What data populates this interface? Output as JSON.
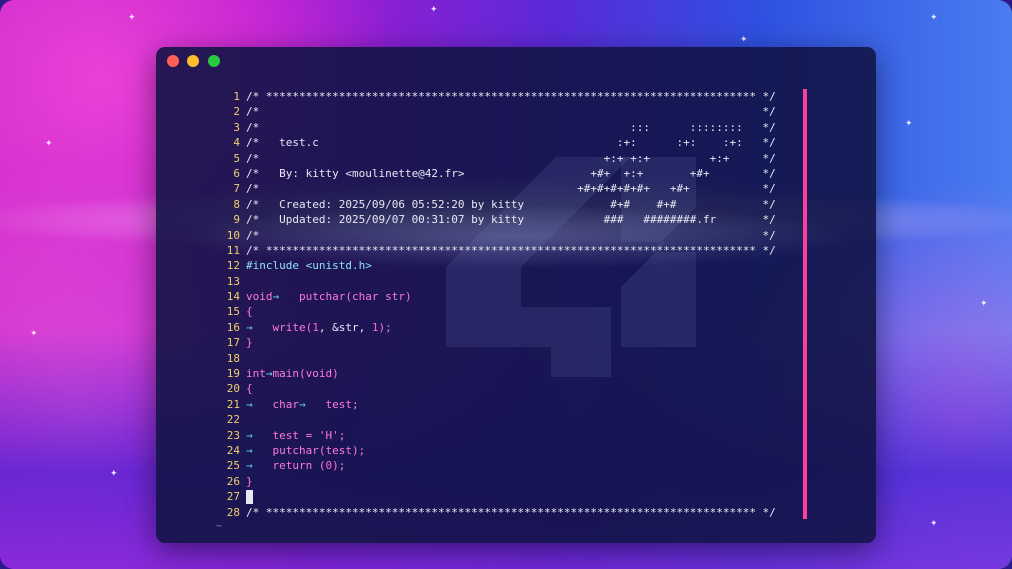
{
  "window": {
    "controls": [
      "close",
      "minimize",
      "zoom"
    ],
    "accent_colors": {
      "close": "#ff5f57",
      "minimize": "#febc2e",
      "zoom": "#28c840",
      "cursorline_bar": "#ff3d9e"
    }
  },
  "editor": {
    "empty_line_marker": "~",
    "lines": [
      {
        "n": "1",
        "text": "/* ************************************************************************** */",
        "kind": "comment"
      },
      {
        "n": "2",
        "text": "/*                                                                            */",
        "kind": "comment"
      },
      {
        "n": "3",
        "text": "/*                                                        :::      ::::::::   */",
        "kind": "comment"
      },
      {
        "n": "4",
        "text": "/*   test.c                                             :+:      :+:    :+:   */",
        "kind": "comment"
      },
      {
        "n": "5",
        "text": "/*                                                    +:+ +:+         +:+     */",
        "kind": "comment"
      },
      {
        "n": "6",
        "text": "/*   By: kitty <moulinette@42.fr>                   +#+  +:+       +#+        */",
        "kind": "comment"
      },
      {
        "n": "7",
        "text": "/*                                                +#+#+#+#+#+   +#+           */",
        "kind": "comment"
      },
      {
        "n": "8",
        "text": "/*   Created: 2025/09/06 05:52:20 by kitty             #+#    #+#             */",
        "kind": "comment"
      },
      {
        "n": "9",
        "text": "/*   Updated: 2025/09/07 00:31:07 by kitty            ###   ########.fr       */",
        "kind": "comment"
      },
      {
        "n": "10",
        "text": "/*                                                                            */",
        "kind": "comment"
      },
      {
        "n": "11",
        "text": "/* ************************************************************************** */",
        "kind": "comment"
      },
      {
        "n": "12",
        "parts": [
          {
            "t": "#include <unistd.h>",
            "c": "c-inc"
          }
        ]
      },
      {
        "n": "13",
        "parts": []
      },
      {
        "n": "14",
        "parts": [
          {
            "t": "void",
            "c": "c-kw"
          },
          {
            "t": "→   ",
            "c": "c-arrow"
          },
          {
            "t": "putchar",
            "c": "c-fn"
          },
          {
            "t": "(",
            "c": "c-brace"
          },
          {
            "t": "char str",
            "c": "c-kw"
          },
          {
            "t": ")",
            "c": "c-brace"
          }
        ]
      },
      {
        "n": "15",
        "parts": [
          {
            "t": "{",
            "c": "c-brace"
          }
        ]
      },
      {
        "n": "16",
        "parts": [
          {
            "t": "→   ",
            "c": "c-arrow"
          },
          {
            "t": "write",
            "c": "c-fn"
          },
          {
            "t": "(",
            "c": "c-brace"
          },
          {
            "t": "1",
            "c": "c-num"
          },
          {
            "t": ", &str, ",
            "c": "c-str"
          },
          {
            "t": "1",
            "c": "c-num"
          },
          {
            "t": ");",
            "c": "c-brace"
          }
        ]
      },
      {
        "n": "17",
        "parts": [
          {
            "t": "}",
            "c": "c-brace"
          }
        ]
      },
      {
        "n": "18",
        "parts": []
      },
      {
        "n": "19",
        "parts": [
          {
            "t": "int",
            "c": "c-kw"
          },
          {
            "t": "→",
            "c": "c-arrow"
          },
          {
            "t": "main",
            "c": "c-fn"
          },
          {
            "t": "(",
            "c": "c-brace"
          },
          {
            "t": "void",
            "c": "c-kw"
          },
          {
            "t": ")",
            "c": "c-brace"
          }
        ]
      },
      {
        "n": "20",
        "parts": [
          {
            "t": "{",
            "c": "c-brace"
          }
        ]
      },
      {
        "n": "21",
        "parts": [
          {
            "t": "→   ",
            "c": "c-arrow"
          },
          {
            "t": "char",
            "c": "c-kw"
          },
          {
            "t": "→   ",
            "c": "c-arrow"
          },
          {
            "t": "test;",
            "c": "c-kw"
          }
        ]
      },
      {
        "n": "22",
        "parts": []
      },
      {
        "n": "23",
        "parts": [
          {
            "t": "→   ",
            "c": "c-arrow"
          },
          {
            "t": "test = 'H';",
            "c": "c-kw"
          }
        ]
      },
      {
        "n": "24",
        "parts": [
          {
            "t": "→   ",
            "c": "c-arrow"
          },
          {
            "t": "putchar(test);",
            "c": "c-kw"
          }
        ]
      },
      {
        "n": "25",
        "parts": [
          {
            "t": "→   ",
            "c": "c-arrow"
          },
          {
            "t": "return ",
            "c": "c-kw"
          },
          {
            "t": "(",
            "c": "c-brace"
          },
          {
            "t": "0",
            "c": "c-num"
          },
          {
            "t": ");",
            "c": "c-brace"
          }
        ]
      },
      {
        "n": "26",
        "parts": [
          {
            "t": "}",
            "c": "c-brace"
          }
        ]
      },
      {
        "n": "27",
        "parts": [],
        "cursor": true
      },
      {
        "n": "28",
        "text": "/* ************************************************************************** */",
        "kind": "comment"
      }
    ]
  }
}
